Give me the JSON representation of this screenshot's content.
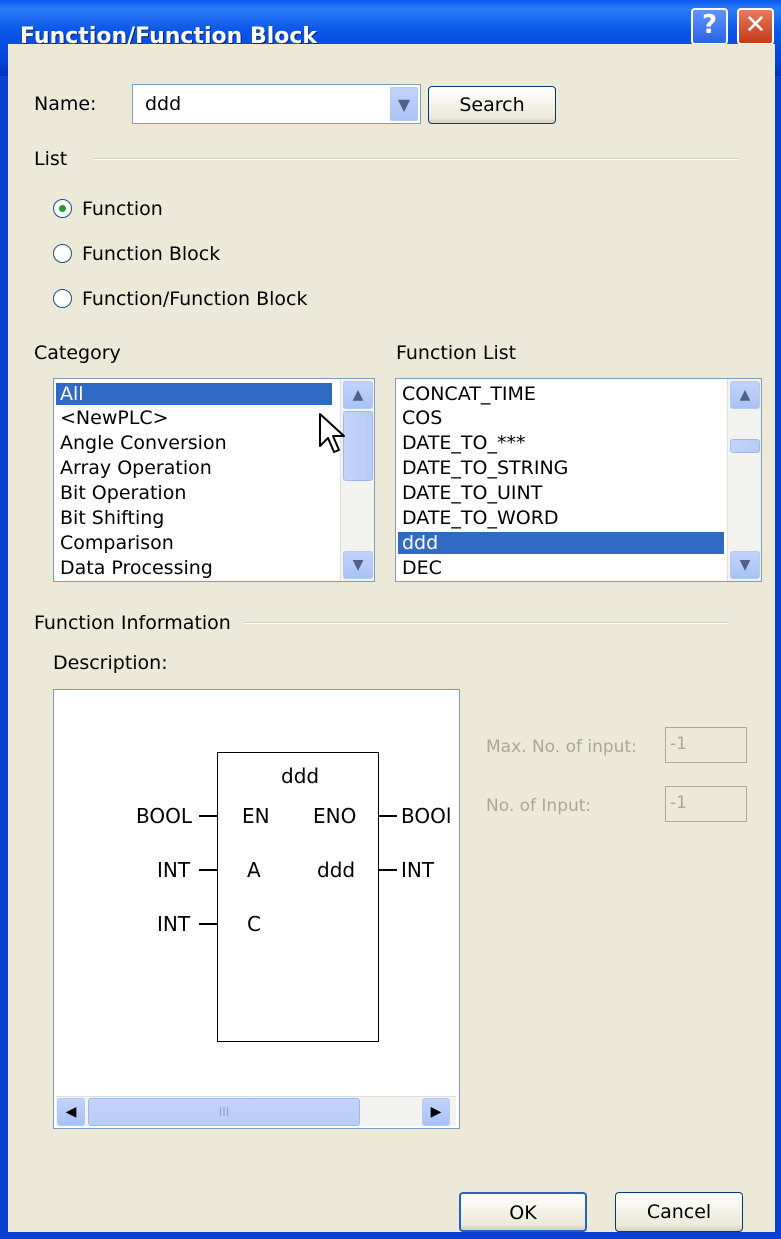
{
  "window": {
    "title": "Function/Function Block",
    "help_glyph": "?",
    "close_glyph": "✕"
  },
  "name_row": {
    "label": "Name:",
    "value": "ddd",
    "search_label": "Search"
  },
  "list_group": {
    "label": "List",
    "options": [
      {
        "label": "Function",
        "selected": true
      },
      {
        "label": "Function Block",
        "selected": false
      },
      {
        "label": "Function/Function Block",
        "selected": false
      }
    ]
  },
  "category": {
    "label": "Category",
    "items": [
      "All",
      "<NewPLC>",
      "Angle Conversion",
      "Array Operation",
      "Bit Operation",
      "Bit Shifting",
      "Comparison",
      "Data Processing"
    ],
    "selected_index": 0
  },
  "function_list": {
    "label": "Function List",
    "items": [
      "CONCAT_TIME",
      "COS",
      "DATE_TO_***",
      "DATE_TO_STRING",
      "DATE_TO_UINT",
      "DATE_TO_WORD",
      "ddd",
      "DEC"
    ],
    "selected_index": 6
  },
  "function_info": {
    "label": "Function Information",
    "description_label": "Description:",
    "block": {
      "name": "ddd",
      "inputs": [
        {
          "type": "BOOL",
          "pin": "EN"
        },
        {
          "type": "INT",
          "pin": "A"
        },
        {
          "type": "INT",
          "pin": "C"
        }
      ],
      "outputs": [
        {
          "pin": "ENO",
          "type": "BOOl"
        },
        {
          "pin": "ddd",
          "type": "INT"
        }
      ]
    },
    "hscroll_glyph": "III",
    "max_inputs_label": "Max. No. of input:",
    "max_inputs_value": "-1",
    "num_inputs_label": "No. of Input:",
    "num_inputs_value": "-1"
  },
  "buttons": {
    "ok": "OK",
    "cancel": "Cancel"
  }
}
